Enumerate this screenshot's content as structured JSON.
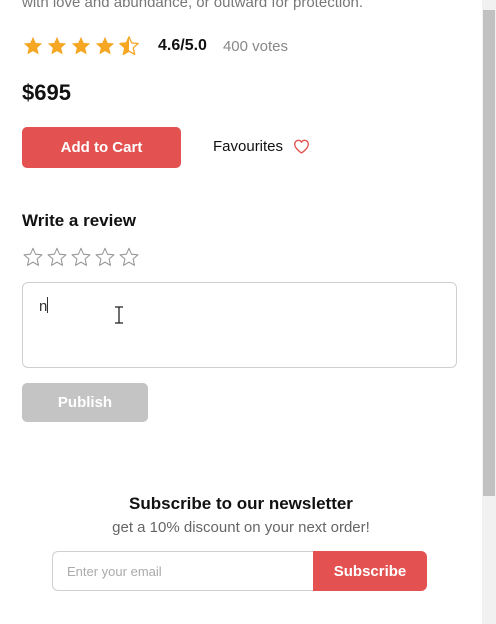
{
  "product": {
    "description_tail": "with love and abundance, or outward for protection.",
    "rating": {
      "stars_value": 4.5,
      "value_label": "4.6/5.0",
      "votes_label": "400 votes"
    },
    "price": "$695",
    "add_to_cart_label": "Add to Cart",
    "favourites_label": "Favourites"
  },
  "review": {
    "title": "Write a review",
    "selected_stars": 0,
    "text": "n",
    "publish_label": "Publish"
  },
  "newsletter": {
    "title": "Subscribe to our newsletter",
    "subtitle": "get a 10% discount on your next order!",
    "email_placeholder": "Enter your email",
    "subscribe_label": "Subscribe"
  },
  "colors": {
    "accent": "#e35151",
    "star": "#f5a623",
    "disabled": "#c4c4c4"
  }
}
